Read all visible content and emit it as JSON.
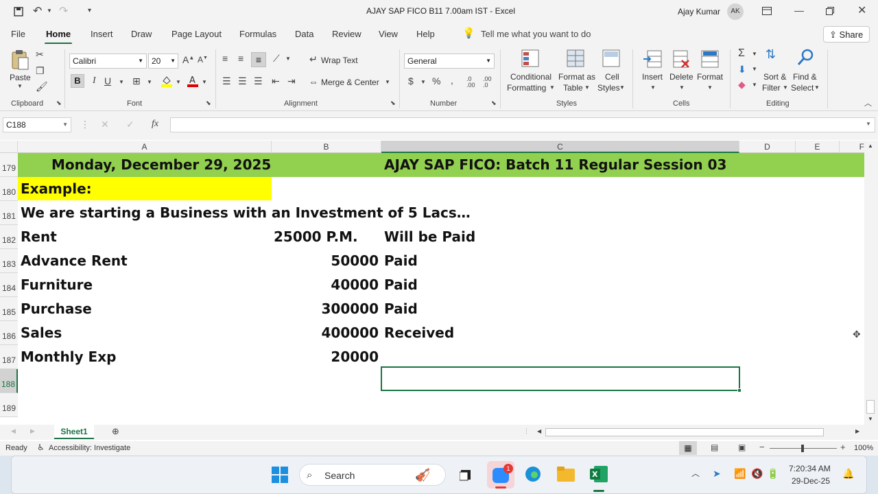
{
  "window": {
    "title": "AJAY SAP FICO B11 7.00am IST  -  Excel",
    "user": "Ajay Kumar",
    "initials": "AK"
  },
  "menu": [
    "File",
    "Home",
    "Insert",
    "Draw",
    "Page Layout",
    "Formulas",
    "Data",
    "Review",
    "View",
    "Help"
  ],
  "tell_me": "Tell me what you want to do",
  "share": "Share",
  "ribbon": {
    "paste": "Paste",
    "clipboard": "Clipboard",
    "font_name": "Calibri",
    "font_size": "20",
    "font": "Font",
    "wrap_text": "Wrap Text",
    "merge_center": "Merge & Center",
    "alignment": "Alignment",
    "number_format": "General",
    "number": "Number",
    "conditional_1": "Conditional",
    "conditional_2": "Formatting",
    "format_as_1": "Format as",
    "format_as_2": "Table",
    "cell_styles_1": "Cell",
    "cell_styles_2": "Styles",
    "styles": "Styles",
    "insert": "Insert",
    "delete": "Delete",
    "format": "Format",
    "cells": "Cells",
    "sort_1": "Sort &",
    "sort_2": "Filter",
    "find_1": "Find &",
    "find_2": "Select",
    "editing": "Editing"
  },
  "formula": {
    "name_box": "C188",
    "fx": "fx",
    "value": ""
  },
  "columns": [
    "A",
    "B",
    "C",
    "D",
    "E",
    "F"
  ],
  "rows": [
    {
      "n": "179",
      "a": "Monday, December 29, 2025",
      "b": "",
      "c": "AJAY SAP FICO: Batch 11 Regular Session 03"
    },
    {
      "n": "180",
      "a": "Example:",
      "b": "",
      "c": ""
    },
    {
      "n": "181",
      "a": "We are starting a Business with an Investment of 5 Lacs…",
      "b": "",
      "c": ""
    },
    {
      "n": "182",
      "a": "Rent",
      "b": "25000 P.M.",
      "c": "Will be Paid"
    },
    {
      "n": "183",
      "a": "Advance Rent",
      "b": "50000",
      "c": "Paid"
    },
    {
      "n": "184",
      "a": "Furniture",
      "b": "40000",
      "c": "Paid"
    },
    {
      "n": "185",
      "a": "Purchase",
      "b": "300000",
      "c": "Paid"
    },
    {
      "n": "186",
      "a": "Sales",
      "b": "400000",
      "c": "Received"
    },
    {
      "n": "187",
      "a": "Monthly Exp",
      "b": "20000",
      "c": ""
    },
    {
      "n": "188",
      "a": "",
      "b": "",
      "c": ""
    },
    {
      "n": "189",
      "a": "",
      "b": "",
      "c": ""
    }
  ],
  "sheet_tab": "Sheet1",
  "status": {
    "ready": "Ready",
    "accessibility": "Accessibility: Investigate",
    "zoom": "100%"
  },
  "taskbar": {
    "search": "Search",
    "time": "7:20:34 AM",
    "date": "29-Dec-25",
    "zoom_badge": "1"
  },
  "colors": {
    "header_fill": "#92d050",
    "example_fill": "#ffff00",
    "excel_green": "#1a7343"
  }
}
